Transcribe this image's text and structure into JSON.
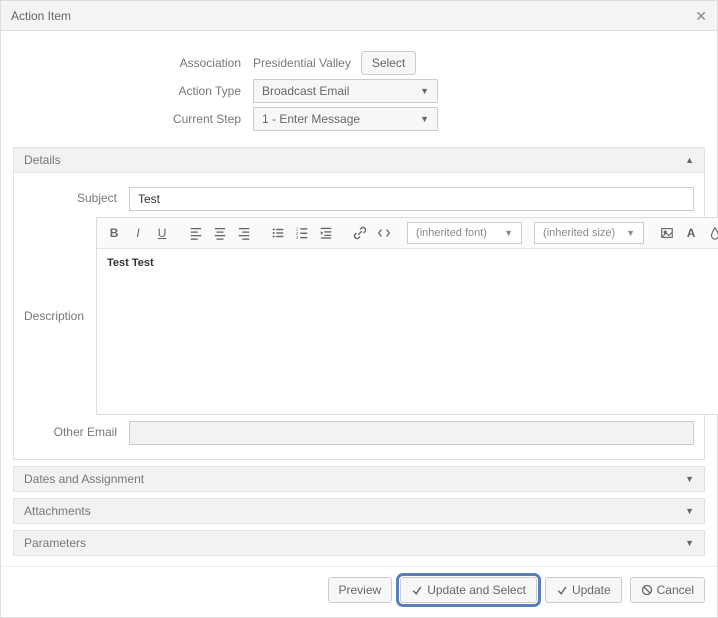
{
  "dialog": {
    "title": "Action Item"
  },
  "top_form": {
    "association_label": "Association",
    "association_value": "Presidential Valley",
    "select_button": "Select",
    "action_type_label": "Action Type",
    "action_type_value": "Broadcast Email",
    "current_step_label": "Current Step",
    "current_step_value": "1 - Enter Message"
  },
  "sections": {
    "details": "Details",
    "dates": "Dates and Assignment",
    "attachments": "Attachments",
    "parameters": "Parameters"
  },
  "details": {
    "subject_label": "Subject",
    "subject_value": "Test",
    "description_label": "Description",
    "description_body": "Test Test",
    "other_email_label": "Other Email",
    "other_email_value": ""
  },
  "toolbar": {
    "font_label": "(inherited font)",
    "size_label": "(inherited size)"
  },
  "footer": {
    "preview": "Preview",
    "update_and_select": "Update and Select",
    "update": "Update",
    "cancel": "Cancel"
  }
}
